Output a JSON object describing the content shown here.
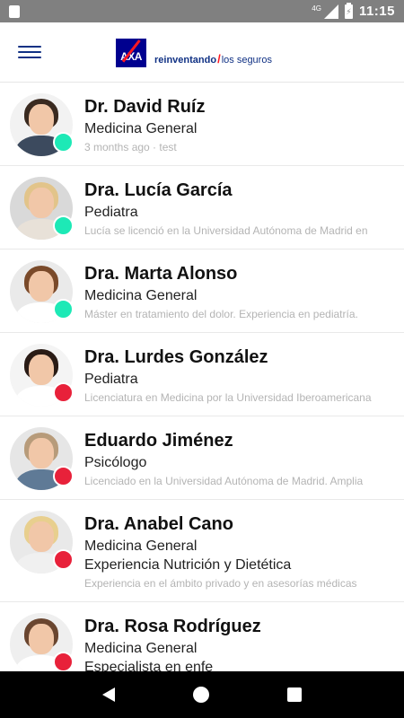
{
  "status_bar": {
    "network": "4G",
    "time": "11:15"
  },
  "app_bar": {
    "logo_text": "AXA",
    "tagline_bold": "reinventando",
    "tagline_slash": "/",
    "tagline_rest": "los seguros"
  },
  "colors": {
    "online": "#1de9b6",
    "offline": "#e8213a",
    "brand_blue": "#00008f",
    "brand_red": "#ff1721"
  },
  "doctors": [
    {
      "name": "Dr. David Ruíz",
      "specialty": "Medicina General",
      "specialty2": "",
      "description": "3 months ago · test",
      "status": "online",
      "avatar_icon": "doctor-male-avatar"
    },
    {
      "name": "Dra. Lucía García",
      "specialty": "Pediatra",
      "specialty2": "",
      "description": "Lucía se licenció en la Universidad Autónoma de Madrid en",
      "status": "online",
      "avatar_icon": "doctor-female-avatar"
    },
    {
      "name": "Dra. Marta Alonso",
      "specialty": "Medicina General",
      "specialty2": "",
      "description": "Máster en tratamiento del  dolor. Experiencia en pediatría.",
      "status": "online",
      "avatar_icon": "doctor-female-avatar"
    },
    {
      "name": "Dra. Lurdes González",
      "specialty": "Pediatra",
      "specialty2": "",
      "description": "Licenciatura en Medicina por la Universidad Iberoamericana",
      "status": "offline",
      "avatar_icon": "doctor-female-avatar"
    },
    {
      "name": "Eduardo Jiménez",
      "specialty": "Psicólogo",
      "specialty2": "",
      "description": "Licenciado en la Universidad Autónoma de Madrid. Amplia",
      "status": "offline",
      "avatar_icon": "doctor-male-avatar"
    },
    {
      "name": "Dra. Anabel Cano",
      "specialty": "Medicina General",
      "specialty2": "Experiencia Nutrición y Dietética",
      "description": "Experiencia en el ámbito privado y en asesorías médicas",
      "status": "offline",
      "avatar_icon": "doctor-female-avatar"
    },
    {
      "name": "Dra. Rosa Rodríguez",
      "specialty": "Medicina General",
      "specialty2": "Especialista en enfe",
      "description": "",
      "status": "offline",
      "avatar_icon": "doctor-female-avatar"
    }
  ]
}
